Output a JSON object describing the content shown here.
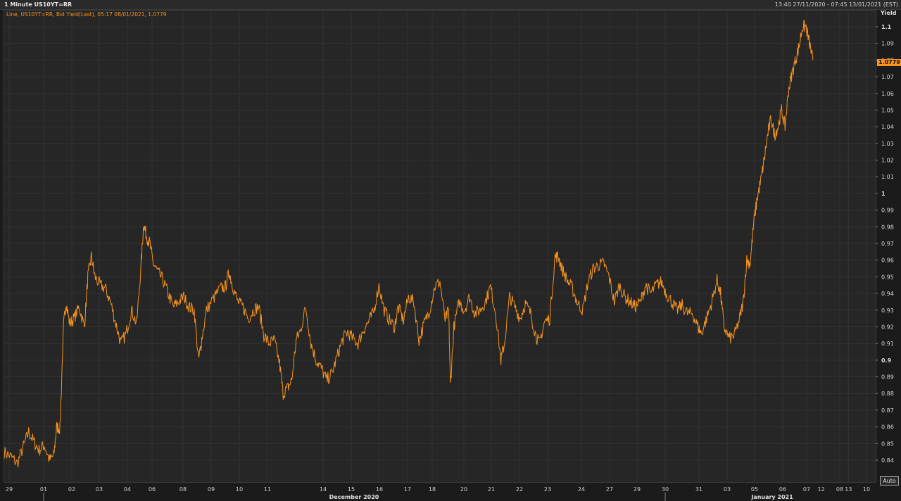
{
  "header": {
    "title": "1 Minute US10YT=RR",
    "range": "13:40 27/11/2020 - 07:45 13/01/2021 (EST)"
  },
  "legend": "Line, US10YT=RR, Bid Yield(Last), 05:17 08/01/2021, 1.0779",
  "last_value": "1.0779",
  "auto_label": "Auto",
  "colors": {
    "line": "#f7931e",
    "background": "#262626",
    "grid": "#333333"
  },
  "chart_data": {
    "type": "line",
    "title": "1 Minute US10YT=RR",
    "ylabel": "Yield",
    "ylim": [
      0.835,
      1.1
    ],
    "y_ticks": [
      0.84,
      0.85,
      0.86,
      0.87,
      0.88,
      0.89,
      0.9,
      0.91,
      0.92,
      0.93,
      0.94,
      0.95,
      0.96,
      0.97,
      0.98,
      0.99,
      1,
      1.01,
      1.02,
      1.03,
      1.04,
      1.05,
      1.06,
      1.07,
      1.08,
      1.09,
      1.1
    ],
    "y_tick_labels": [
      "0.84",
      "0.85",
      "0.86",
      "0.87",
      "0.88",
      "0.89",
      "0.9",
      "0.91",
      "0.92",
      "0.93",
      "0.94",
      "0.95",
      "0.96",
      "0.97",
      "0.98",
      "0.99",
      "1",
      "1.01",
      "1.02",
      "1.03",
      "1.04",
      "1.05",
      "1.06",
      "1.07",
      "1.08",
      "1.09",
      "1.1"
    ],
    "x_ticks": [
      "29",
      "01",
      "02",
      "03",
      "04",
      "06",
      "08",
      "09",
      "10",
      "11",
      "14",
      "15",
      "16",
      "17",
      "18",
      "20",
      "21",
      "22",
      "23",
      "24",
      "27",
      "29",
      "30",
      "31",
      "03",
      "05",
      "06",
      "07",
      "08",
      "10",
      "12",
      "13"
    ],
    "x_month_labels": [
      "December 2020",
      "January 2021"
    ],
    "grid": true,
    "series": [
      {
        "values": [
          [
            0,
            0.845
          ],
          [
            0.008,
            0.842
          ],
          [
            0.015,
            0.838
          ],
          [
            0.022,
            0.848
          ],
          [
            0.028,
            0.857
          ],
          [
            0.034,
            0.851
          ],
          [
            0.04,
            0.846
          ],
          [
            0.046,
            0.849
          ],
          [
            0.052,
            0.84
          ],
          [
            0.057,
            0.843
          ],
          [
            0.06,
            0.86
          ],
          [
            0.064,
            0.859
          ],
          [
            0.068,
            0.92
          ],
          [
            0.071,
            0.935
          ],
          [
            0.075,
            0.922
          ],
          [
            0.08,
            0.925
          ],
          [
            0.086,
            0.932
          ],
          [
            0.092,
            0.92
          ],
          [
            0.096,
            0.95
          ],
          [
            0.1,
            0.962
          ],
          [
            0.104,
            0.95
          ],
          [
            0.11,
            0.945
          ],
          [
            0.116,
            0.943
          ],
          [
            0.122,
            0.935
          ],
          [
            0.128,
            0.922
          ],
          [
            0.134,
            0.91
          ],
          [
            0.14,
            0.916
          ],
          [
            0.146,
            0.93
          ],
          [
            0.152,
            0.922
          ],
          [
            0.157,
            0.957
          ],
          [
            0.16,
            0.982
          ],
          [
            0.163,
            0.975
          ],
          [
            0.167,
            0.97
          ],
          [
            0.171,
            0.958
          ],
          [
            0.176,
            0.953
          ],
          [
            0.182,
            0.948
          ],
          [
            0.188,
            0.94
          ],
          [
            0.194,
            0.932
          ],
          [
            0.2,
            0.935
          ],
          [
            0.206,
            0.938
          ],
          [
            0.212,
            0.932
          ],
          [
            0.218,
            0.93
          ],
          [
            0.223,
            0.9
          ],
          [
            0.226,
            0.91
          ],
          [
            0.232,
            0.93
          ],
          [
            0.24,
            0.937
          ],
          [
            0.248,
            0.943
          ],
          [
            0.254,
            0.944
          ],
          [
            0.258,
            0.953
          ],
          [
            0.262,
            0.945
          ],
          [
            0.268,
            0.935
          ],
          [
            0.274,
            0.932
          ],
          [
            0.28,
            0.925
          ],
          [
            0.286,
            0.93
          ],
          [
            0.292,
            0.932
          ],
          [
            0.298,
            0.915
          ],
          [
            0.304,
            0.91
          ],
          [
            0.31,
            0.912
          ],
          [
            0.316,
            0.898
          ],
          [
            0.32,
            0.88
          ],
          [
            0.325,
            0.883
          ],
          [
            0.33,
            0.888
          ],
          [
            0.335,
            0.912
          ],
          [
            0.34,
            0.918
          ],
          [
            0.346,
            0.932
          ],
          [
            0.352,
            0.91
          ],
          [
            0.358,
            0.9
          ],
          [
            0.364,
            0.895
          ],
          [
            0.37,
            0.888
          ],
          [
            0.376,
            0.892
          ],
          [
            0.382,
            0.902
          ],
          [
            0.388,
            0.912
          ],
          [
            0.394,
            0.917
          ],
          [
            0.4,
            0.913
          ],
          [
            0.406,
            0.91
          ],
          [
            0.412,
            0.918
          ],
          [
            0.418,
            0.923
          ],
          [
            0.424,
            0.929
          ],
          [
            0.43,
            0.945
          ],
          [
            0.436,
            0.93
          ],
          [
            0.442,
            0.924
          ],
          [
            0.448,
            0.92
          ],
          [
            0.452,
            0.932
          ],
          [
            0.458,
            0.924
          ],
          [
            0.464,
            0.938
          ],
          [
            0.47,
            0.935
          ],
          [
            0.476,
            0.912
          ],
          [
            0.482,
            0.922
          ],
          [
            0.488,
            0.93
          ],
          [
            0.494,
            0.944
          ],
          [
            0.5,
            0.947
          ],
          [
            0.506,
            0.924
          ],
          [
            0.51,
            0.93
          ],
          [
            0.512,
            0.885
          ],
          [
            0.516,
            0.92
          ],
          [
            0.522,
            0.935
          ],
          [
            0.528,
            0.93
          ],
          [
            0.534,
            0.938
          ],
          [
            0.54,
            0.928
          ],
          [
            0.546,
            0.93
          ],
          [
            0.552,
            0.935
          ],
          [
            0.558,
            0.944
          ],
          [
            0.564,
            0.928
          ],
          [
            0.57,
            0.9
          ],
          [
            0.574,
            0.91
          ],
          [
            0.58,
            0.938
          ],
          [
            0.586,
            0.932
          ],
          [
            0.592,
            0.925
          ],
          [
            0.598,
            0.934
          ],
          [
            0.604,
            0.928
          ],
          [
            0.61,
            0.915
          ],
          [
            0.614,
            0.91
          ],
          [
            0.62,
            0.923
          ],
          [
            0.626,
            0.925
          ],
          [
            0.632,
            0.962
          ],
          [
            0.636,
            0.962
          ],
          [
            0.64,
            0.955
          ],
          [
            0.646,
            0.948
          ],
          [
            0.652,
            0.943
          ],
          [
            0.658,
            0.934
          ],
          [
            0.664,
            0.93
          ],
          [
            0.67,
            0.947
          ],
          [
            0.676,
            0.955
          ],
          [
            0.682,
            0.957
          ],
          [
            0.688,
            0.958
          ],
          [
            0.694,
            0.95
          ],
          [
            0.7,
            0.935
          ],
          [
            0.706,
            0.945
          ],
          [
            0.712,
            0.938
          ],
          [
            0.718,
            0.935
          ],
          [
            0.724,
            0.932
          ],
          [
            0.73,
            0.935
          ],
          [
            0.736,
            0.945
          ],
          [
            0.742,
            0.94
          ],
          [
            0.748,
            0.945
          ],
          [
            0.754,
            0.947
          ],
          [
            0.76,
            0.94
          ],
          [
            0.766,
            0.935
          ],
          [
            0.772,
            0.93
          ],
          [
            0.778,
            0.933
          ],
          [
            0.784,
            0.928
          ],
          [
            0.79,
            0.928
          ],
          [
            0.796,
            0.92
          ],
          [
            0.8,
            0.916
          ],
          [
            0.806,
            0.925
          ],
          [
            0.812,
            0.935
          ],
          [
            0.818,
            0.948
          ],
          [
            0.822,
            0.94
          ],
          [
            0.826,
            0.92
          ],
          [
            0.832,
            0.913
          ],
          [
            0.838,
            0.915
          ],
          [
            0.844,
            0.925
          ],
          [
            0.848,
            0.935
          ],
          [
            0.852,
            0.96
          ],
          [
            0.856,
            0.958
          ],
          [
            0.86,
            0.982
          ],
          [
            0.864,
            0.997
          ],
          [
            0.868,
            1.007
          ],
          [
            0.872,
            1.02
          ],
          [
            0.876,
            1.035
          ],
          [
            0.88,
            1.045
          ],
          [
            0.884,
            1.035
          ],
          [
            0.888,
            1.04
          ],
          [
            0.892,
            1.05
          ],
          [
            0.896,
            1.04
          ],
          [
            0.9,
            1.062
          ],
          [
            0.904,
            1.072
          ],
          [
            0.908,
            1.08
          ],
          [
            0.912,
            1.088
          ],
          [
            0.916,
            1.1
          ],
          [
            0.92,
            1.1
          ],
          [
            0.924,
            1.09
          ],
          [
            0.928,
            1.08
          ]
        ]
      }
    ]
  }
}
